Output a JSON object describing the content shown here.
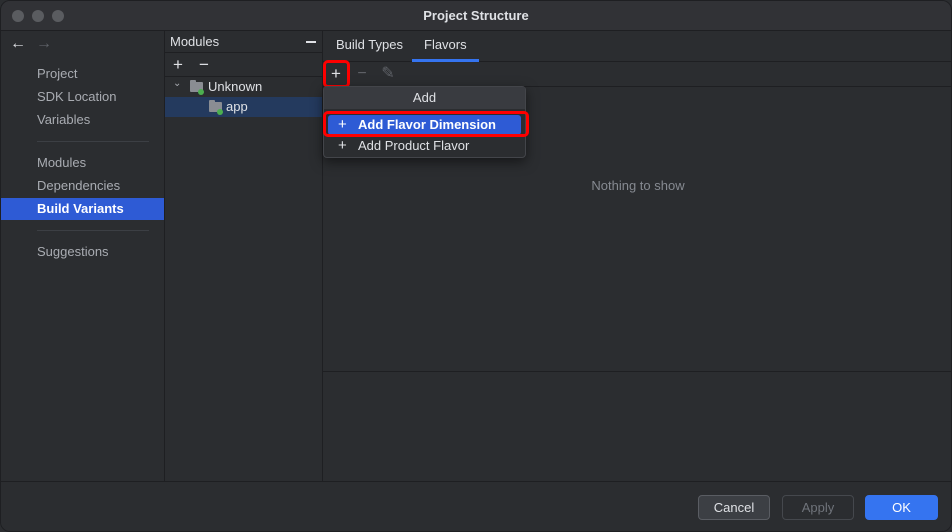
{
  "window": {
    "title": "Project Structure"
  },
  "nav": {
    "back_arrow": "←",
    "forward_arrow": "→",
    "items": [
      {
        "label": "Project"
      },
      {
        "label": "SDK Location"
      },
      {
        "label": "Variables"
      },
      {
        "label": "Modules"
      },
      {
        "label": "Dependencies"
      },
      {
        "label": "Build Variants",
        "selected": true
      },
      {
        "label": "Suggestions"
      }
    ]
  },
  "modules": {
    "header": "Modules",
    "add": "+",
    "remove": "−",
    "tree": [
      {
        "label": "Unknown",
        "expand": "⌄"
      },
      {
        "label": "app",
        "selected": true
      }
    ]
  },
  "content": {
    "tabs": [
      {
        "label": "Build Types"
      },
      {
        "label": "Flavors",
        "active": true
      }
    ],
    "toolbar": {
      "add": "+",
      "remove": "−",
      "edit": "✎"
    },
    "empty_text": "Nothing to show"
  },
  "popup": {
    "title": "Add",
    "items": [
      {
        "icon": "+",
        "label": "Add Flavor Dimension",
        "active": true
      },
      {
        "icon": "+",
        "label": "Add Product Flavor"
      }
    ]
  },
  "footer": {
    "cancel": "Cancel",
    "apply": "Apply",
    "ok": "OK"
  },
  "colors": {
    "accent": "#3574f0",
    "selection": "#2e5bd5",
    "highlight": "#ff0000"
  }
}
